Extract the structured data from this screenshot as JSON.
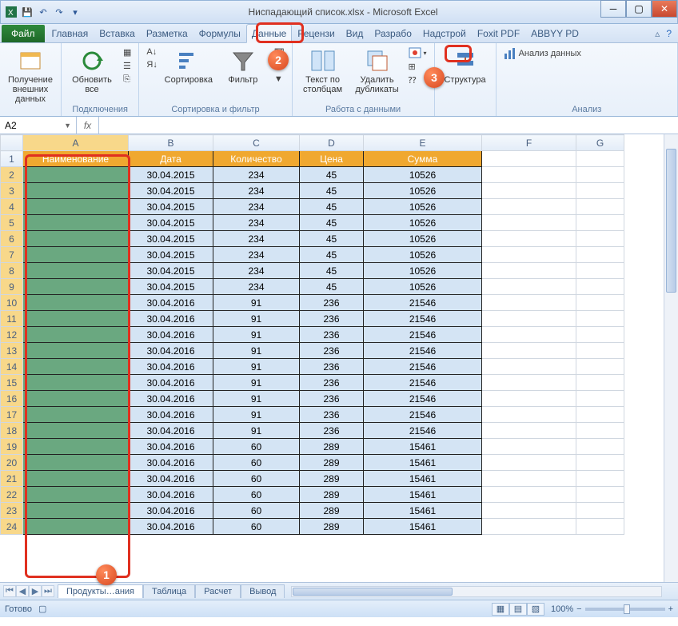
{
  "window": {
    "title": "Ниспадающий список.xlsx - Microsoft Excel"
  },
  "ribbon": {
    "file": "Файл",
    "tabs": [
      "Главная",
      "Вставка",
      "Разметка",
      "Формулы",
      "Данные",
      "Рецензи",
      "Вид",
      "Разрабо",
      "Надстрой",
      "Foxit PDF",
      "ABBYY PD"
    ],
    "active_tab_index": 4,
    "groups": {
      "external": {
        "btn": "Получение внешних данных",
        "label": ""
      },
      "connections": {
        "refresh": "Обновить все",
        "label": "Подключения"
      },
      "sort_filter": {
        "sort": "Сортировка",
        "filter": "Фильтр",
        "label": "Сортировка и фильтр"
      },
      "data_tools": {
        "text_cols": "Текст по столбцам",
        "dedup": "Удалить дубликаты",
        "label": "Работа с данными"
      },
      "outline": {
        "btn": "Структура",
        "label": ""
      },
      "analysis": {
        "btn": "Анализ данных",
        "label": "Анализ"
      }
    }
  },
  "formula_bar": {
    "name_box": "A2",
    "formula": ""
  },
  "columns": [
    "A",
    "B",
    "C",
    "D",
    "E",
    "F",
    "G"
  ],
  "headers": {
    "A": "Наименование",
    "B": "Дата",
    "C": "Количество",
    "D": "Цена",
    "E": "Сумма"
  },
  "rows": [
    {
      "r": 2,
      "B": "30.04.2015",
      "C": "234",
      "D": "45",
      "E": "10526"
    },
    {
      "r": 3,
      "B": "30.04.2015",
      "C": "234",
      "D": "45",
      "E": "10526"
    },
    {
      "r": 4,
      "B": "30.04.2015",
      "C": "234",
      "D": "45",
      "E": "10526"
    },
    {
      "r": 5,
      "B": "30.04.2015",
      "C": "234",
      "D": "45",
      "E": "10526"
    },
    {
      "r": 6,
      "B": "30.04.2015",
      "C": "234",
      "D": "45",
      "E": "10526"
    },
    {
      "r": 7,
      "B": "30.04.2015",
      "C": "234",
      "D": "45",
      "E": "10526"
    },
    {
      "r": 8,
      "B": "30.04.2015",
      "C": "234",
      "D": "45",
      "E": "10526"
    },
    {
      "r": 9,
      "B": "30.04.2015",
      "C": "234",
      "D": "45",
      "E": "10526"
    },
    {
      "r": 10,
      "B": "30.04.2016",
      "C": "91",
      "D": "236",
      "E": "21546"
    },
    {
      "r": 11,
      "B": "30.04.2016",
      "C": "91",
      "D": "236",
      "E": "21546"
    },
    {
      "r": 12,
      "B": "30.04.2016",
      "C": "91",
      "D": "236",
      "E": "21546"
    },
    {
      "r": 13,
      "B": "30.04.2016",
      "C": "91",
      "D": "236",
      "E": "21546"
    },
    {
      "r": 14,
      "B": "30.04.2016",
      "C": "91",
      "D": "236",
      "E": "21546"
    },
    {
      "r": 15,
      "B": "30.04.2016",
      "C": "91",
      "D": "236",
      "E": "21546"
    },
    {
      "r": 16,
      "B": "30.04.2016",
      "C": "91",
      "D": "236",
      "E": "21546"
    },
    {
      "r": 17,
      "B": "30.04.2016",
      "C": "91",
      "D": "236",
      "E": "21546"
    },
    {
      "r": 18,
      "B": "30.04.2016",
      "C": "91",
      "D": "236",
      "E": "21546"
    },
    {
      "r": 19,
      "B": "30.04.2016",
      "C": "60",
      "D": "289",
      "E": "15461"
    },
    {
      "r": 20,
      "B": "30.04.2016",
      "C": "60",
      "D": "289",
      "E": "15461"
    },
    {
      "r": 21,
      "B": "30.04.2016",
      "C": "60",
      "D": "289",
      "E": "15461"
    },
    {
      "r": 22,
      "B": "30.04.2016",
      "C": "60",
      "D": "289",
      "E": "15461"
    },
    {
      "r": 23,
      "B": "30.04.2016",
      "C": "60",
      "D": "289",
      "E": "15461"
    },
    {
      "r": 24,
      "B": "30.04.2016",
      "C": "60",
      "D": "289",
      "E": "15461"
    }
  ],
  "sheet_tabs": {
    "tabs": [
      "Продукты…ания",
      "Таблица",
      "Расчет",
      "Вывод"
    ],
    "active_index": 0
  },
  "status": {
    "ready": "Готово",
    "zoom": "100%"
  },
  "callouts": {
    "c1": "1",
    "c2": "2",
    "c3": "3"
  }
}
